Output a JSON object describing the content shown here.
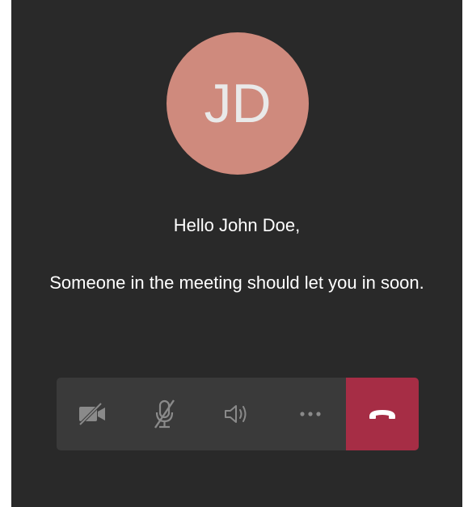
{
  "avatar": {
    "initials": "JD",
    "color": "#cf8a7d"
  },
  "greeting": "Hello John Doe,",
  "message": "Someone in the meeting should let you in soon.",
  "toolbar": {
    "buttons": [
      {
        "name": "camera-off-button",
        "icon": "video-off-icon"
      },
      {
        "name": "mic-muted-button",
        "icon": "mic-off-icon"
      },
      {
        "name": "speaker-button",
        "icon": "speaker-icon"
      },
      {
        "name": "more-options-button",
        "icon": "ellipsis-icon"
      },
      {
        "name": "hang-up-button",
        "icon": "phone-hangup-icon",
        "color": "#a62d45"
      }
    ]
  },
  "colors": {
    "background": "#292929",
    "toolbar": "#3a3a3a",
    "icon": "#8a8a8a"
  }
}
